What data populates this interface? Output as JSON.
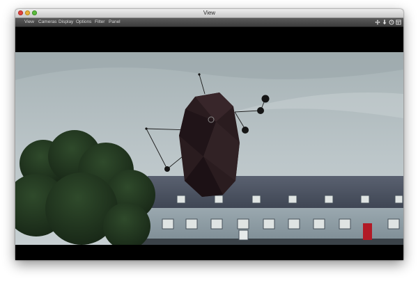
{
  "window": {
    "title": "View"
  },
  "menubar": {
    "items": [
      {
        "label": "View"
      },
      {
        "label": "Cameras"
      },
      {
        "label": "Display"
      },
      {
        "label": "Options"
      },
      {
        "label": "Filter"
      },
      {
        "label": "Panel"
      }
    ]
  },
  "toolbar": {
    "icons": [
      "move-icon",
      "download-arrow-icon",
      "clock-icon",
      "layout-icon"
    ]
  },
  "colors": {
    "titlebar": "#d6d6d6",
    "menubar": "#4a4a4a",
    "letterbox": "#000000",
    "sky": "#b5c0c3",
    "roof": "#4b5260",
    "building_wall": "#8f9ea6",
    "door_accent": "#b21a26"
  }
}
